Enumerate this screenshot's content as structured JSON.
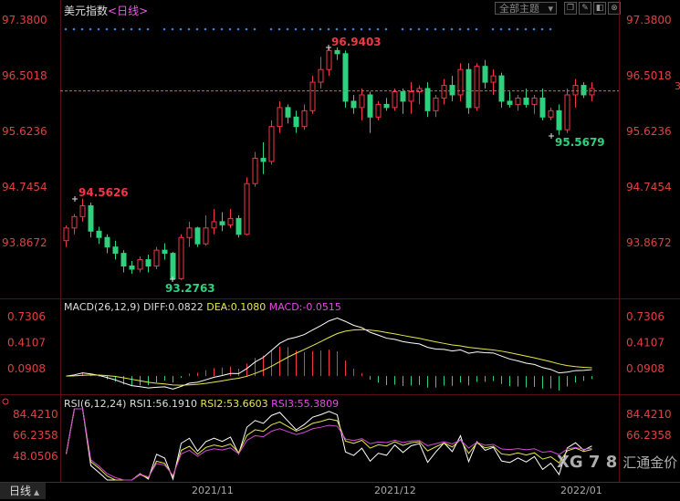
{
  "header": {
    "symbol": "美元指数",
    "period_label": "<日线>",
    "theme_label": "全部主题",
    "theme_arrow": "▾",
    "buttons": [
      "❐",
      "✎",
      "◧",
      "⊗"
    ]
  },
  "price_axis": {
    "labels": [
      "97.3800",
      "96.5018",
      "95.6236",
      "94.7454",
      "93.8672"
    ],
    "right_edge_marker": "3"
  },
  "annotations": {
    "high_label": "96.9403",
    "low_label": "93.2763",
    "local_high_label": "94.5626",
    "recent_low_label": "95.5679"
  },
  "macd": {
    "name": "MACD(26,12,9)",
    "diff": "DIFF:0.0822",
    "dea": "DEA:0.1080",
    "macd": "MACD:-0.0515",
    "axis_labels": [
      "0.7306",
      "0.4107",
      "0.0908"
    ]
  },
  "rsi": {
    "name": "RSI(6,12,24)",
    "rsi1": "RSI1:56.1910",
    "rsi2": "RSI2:53.6603",
    "rsi3": "RSI3:55.3809",
    "left_axis_labels": [
      "84.4210",
      "66.2358",
      "48.0506"
    ],
    "right_axis_labels": [
      "84.4210",
      "66.2358"
    ]
  },
  "bottom": {
    "tab_label": "日线",
    "tab_arrow": "▲",
    "months": [
      "2021/11",
      "2021/12",
      "2022/01"
    ]
  },
  "watermark": {
    "text": "汇通金价",
    "overlay": "XG 7 8"
  },
  "colors": {
    "up": "#f23645",
    "down": "#2ed17e",
    "diff_line": "#ffffff",
    "dea_line": "#e8e84a",
    "macd_label": "#e84ae8",
    "rsi1": "#ffffff",
    "rsi2": "#e8e84a",
    "rsi3": "#d24ad2",
    "grid": "#3a1010",
    "axis_text": "#e04040"
  },
  "chart_data": {
    "type": "candlestick",
    "title": "美元指数",
    "period": "日线",
    "y_range": [
      92.9,
      97.6
    ],
    "ohlc": [
      [
        93.9,
        94.14,
        93.8,
        94.1
      ],
      [
        94.1,
        94.32,
        94.0,
        94.28
      ],
      [
        94.28,
        94.5626,
        94.2,
        94.45
      ],
      [
        94.45,
        94.5,
        93.95,
        94.05
      ],
      [
        94.05,
        94.12,
        93.85,
        93.95
      ],
      [
        93.95,
        94.0,
        93.7,
        93.8
      ],
      [
        93.8,
        93.9,
        93.6,
        93.7
      ],
      [
        93.7,
        93.75,
        93.4,
        93.5
      ],
      [
        93.5,
        93.58,
        93.38,
        93.45
      ],
      [
        93.45,
        93.65,
        93.4,
        93.6
      ],
      [
        93.6,
        93.68,
        93.4,
        93.5
      ],
      [
        93.5,
        93.8,
        93.45,
        93.75
      ],
      [
        93.75,
        93.86,
        93.6,
        93.7
      ],
      [
        93.7,
        93.72,
        93.2763,
        93.3
      ],
      [
        93.3,
        94.0,
        93.28,
        93.95
      ],
      [
        93.95,
        94.2,
        93.8,
        94.1
      ],
      [
        94.1,
        94.12,
        93.8,
        93.85
      ],
      [
        93.85,
        94.3,
        93.82,
        94.1
      ],
      [
        94.1,
        94.4,
        94.0,
        94.2
      ],
      [
        94.2,
        94.35,
        94.05,
        94.15
      ],
      [
        94.15,
        94.4,
        94.1,
        94.25
      ],
      [
        94.25,
        94.3,
        93.95,
        94.0
      ],
      [
        94.0,
        94.9,
        93.98,
        94.8
      ],
      [
        94.8,
        95.3,
        94.75,
        95.2
      ],
      [
        95.2,
        95.45,
        94.95,
        95.15
      ],
      [
        95.15,
        95.8,
        95.1,
        95.7
      ],
      [
        95.7,
        96.1,
        95.6,
        96.0
      ],
      [
        96.0,
        96.05,
        95.75,
        95.85
      ],
      [
        95.85,
        95.95,
        95.6,
        95.7
      ],
      [
        95.7,
        96.05,
        95.65,
        95.95
      ],
      [
        95.95,
        96.5,
        95.9,
        96.4
      ],
      [
        96.4,
        96.8,
        96.3,
        96.6
      ],
      [
        96.6,
        96.9403,
        96.5,
        96.9
      ],
      [
        96.9,
        96.95,
        96.75,
        96.85
      ],
      [
        96.85,
        96.9,
        96.0,
        96.1
      ],
      [
        96.1,
        96.2,
        95.9,
        96.0
      ],
      [
        96.0,
        96.3,
        95.8,
        96.2
      ],
      [
        96.2,
        96.25,
        95.6,
        95.85
      ],
      [
        95.85,
        96.1,
        95.8,
        96.05
      ],
      [
        96.05,
        96.15,
        95.95,
        96.0
      ],
      [
        96.0,
        96.3,
        95.95,
        96.25
      ],
      [
        96.25,
        96.3,
        95.9,
        96.1
      ],
      [
        96.1,
        96.4,
        95.9,
        96.25
      ],
      [
        96.25,
        96.35,
        96.05,
        96.3
      ],
      [
        96.3,
        96.4,
        95.85,
        95.95
      ],
      [
        95.95,
        96.2,
        95.85,
        96.15
      ],
      [
        96.15,
        96.45,
        96.05,
        96.35
      ],
      [
        96.35,
        96.5,
        96.1,
        96.2
      ],
      [
        96.2,
        96.7,
        96.1,
        96.6
      ],
      [
        96.6,
        96.7,
        95.9,
        96.0
      ],
      [
        96.0,
        96.7,
        95.95,
        96.65
      ],
      [
        96.65,
        96.75,
        96.3,
        96.4
      ],
      [
        96.4,
        96.6,
        96.2,
        96.5
      ],
      [
        96.5,
        96.55,
        96.0,
        96.1
      ],
      [
        96.1,
        96.25,
        96.0,
        96.05
      ],
      [
        96.05,
        96.2,
        95.95,
        96.15
      ],
      [
        96.15,
        96.3,
        96.0,
        96.05
      ],
      [
        96.05,
        96.2,
        95.9,
        96.15
      ],
      [
        96.15,
        96.3,
        95.8,
        95.85
      ],
      [
        95.85,
        96.0,
        95.8,
        95.95
      ],
      [
        95.95,
        96.05,
        95.5679,
        95.65
      ],
      [
        95.65,
        96.3,
        95.6,
        96.2
      ],
      [
        96.2,
        96.45,
        96.0,
        96.35
      ],
      [
        96.35,
        96.4,
        96.15,
        96.2
      ],
      [
        96.2,
        96.4,
        96.1,
        96.3
      ]
    ],
    "reference_price": 96.27,
    "x_tick_labels": [
      "2021/11",
      "2021/12",
      "2022/01"
    ]
  }
}
